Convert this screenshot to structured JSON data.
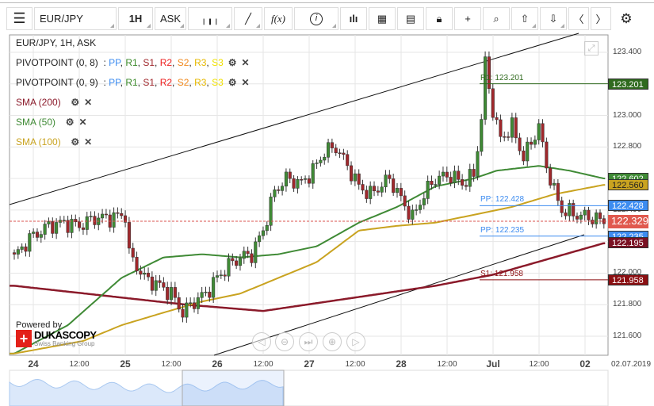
{
  "toolbar": {
    "menu_icon": "hamburger-icon",
    "symbol": "EUR/JPY",
    "period": "1H",
    "side": "ASK",
    "icons": [
      "candle-type-icon",
      "draw-pen-icon",
      "function-fx-icon",
      "info-icon",
      "volume-bars-icon",
      "calendar-icon",
      "report-icon",
      "lock-icon",
      "crosshair-icon",
      "zoom-search-icon",
      "upload-cloud-icon",
      "download-cloud-icon",
      "chevron-left-icon",
      "chevron-right-icon",
      "settings-gear-icon"
    ],
    "fx": "f(x)",
    "info": "i"
  },
  "legend": {
    "title": "EUR/JPY, 1H, ASK",
    "pivots": [
      {
        "name": "PIVOTPOINT (0, 8)"
      },
      {
        "name": "PIVOTPOINT (0, 9)"
      }
    ],
    "pivot_sep": ":",
    "pivot_parts": [
      {
        "t": "PP",
        "c": "#3d8cf0"
      },
      {
        "t": "R1",
        "c": "#3a8a2a"
      },
      {
        "t": "S1",
        "c": "#a0282c"
      },
      {
        "t": "R2",
        "c": "#ee2020"
      },
      {
        "t": "S2",
        "c": "#f08a20"
      },
      {
        "t": "R3",
        "c": "#e6b800"
      },
      {
        "t": "S3",
        "c": "#f0e000"
      }
    ],
    "smas": [
      {
        "name": "SMA (200)",
        "color": "#8b1a2a"
      },
      {
        "name": "SMA (50)",
        "color": "#3f8a35"
      },
      {
        "name": "SMA (100)",
        "color": "#c9a320"
      }
    ]
  },
  "levels": [
    {
      "label": "R1: 123.201",
      "value": 123.201,
      "tag": "123.201",
      "color": "#2f6a1e"
    },
    {
      "label": "PP: 122.428",
      "value": 122.428,
      "tag": "122.428",
      "color": "#3d8cf0"
    },
    {
      "label": "PP: 122.235",
      "value": 122.235,
      "tag": "122.235",
      "color": "#3d8cf0"
    },
    {
      "label": "S1: 121.958",
      "value": 121.958,
      "tag": "121.958",
      "color": "#8b0f12"
    }
  ],
  "tags": {
    "sma50": "122.602",
    "sma100": "122.560",
    "current": "122.329",
    "sma200": "122.195"
  },
  "current_price": 122.329,
  "yaxis": {
    "min": 121.5,
    "max": 123.5,
    "ticks": [
      "123.400",
      "123.200",
      "123.000",
      "122.800",
      "122.600",
      "122.400",
      "122.200",
      "122.000",
      "121.800",
      "121.600"
    ]
  },
  "xaxis": [
    {
      "t": "24",
      "major": true
    },
    {
      "t": "12:00"
    },
    {
      "t": "25",
      "major": true
    },
    {
      "t": "12:00"
    },
    {
      "t": "26",
      "major": true
    },
    {
      "t": "12:00"
    },
    {
      "t": "27",
      "major": true
    },
    {
      "t": "12:00"
    },
    {
      "t": "28",
      "major": true
    },
    {
      "t": "12:00"
    },
    {
      "t": "Jul",
      "major": true
    },
    {
      "t": "12:00"
    },
    {
      "t": "02",
      "major": true
    }
  ],
  "date_label": "02.07.2019",
  "brand": {
    "powered": "Powered by",
    "name": "DUKASCOPY",
    "sub": "Swiss Banking Group"
  },
  "nav_buttons": [
    "scroll-left-icon",
    "zoom-out-icon",
    "reset-icon",
    "zoom-in-icon",
    "scroll-right-icon"
  ],
  "chart_data": {
    "type": "candlestick",
    "hours": 155,
    "close_anchors": [
      [
        0,
        122.1
      ],
      [
        4,
        122.22
      ],
      [
        9,
        122.3
      ],
      [
        13,
        122.32
      ],
      [
        17,
        122.3
      ],
      [
        21,
        122.35
      ],
      [
        25,
        122.35
      ],
      [
        29,
        122.37
      ],
      [
        30,
        122.12
      ],
      [
        34,
        121.97
      ],
      [
        38,
        121.92
      ],
      [
        41,
        121.87
      ],
      [
        44,
        121.75
      ],
      [
        47,
        121.82
      ],
      [
        50,
        121.87
      ],
      [
        53,
        121.97
      ],
      [
        56,
        122.05
      ],
      [
        59,
        122.1
      ],
      [
        62,
        122.12
      ],
      [
        65,
        122.27
      ],
      [
        68,
        122.52
      ],
      [
        71,
        122.6
      ],
      [
        75,
        122.57
      ],
      [
        78,
        122.65
      ],
      [
        81,
        122.77
      ],
      [
        84,
        122.8
      ],
      [
        87,
        122.68
      ],
      [
        90,
        122.55
      ],
      [
        93,
        122.5
      ],
      [
        98,
        122.6
      ],
      [
        101,
        122.47
      ],
      [
        104,
        122.35
      ],
      [
        107,
        122.5
      ],
      [
        110,
        122.6
      ],
      [
        114,
        122.62
      ],
      [
        117,
        122.57
      ],
      [
        120,
        122.62
      ],
      [
        122,
        122.98
      ],
      [
        123,
        123.33
      ],
      [
        125,
        123.03
      ],
      [
        127,
        122.85
      ],
      [
        130,
        122.93
      ],
      [
        133,
        122.73
      ],
      [
        137,
        122.93
      ],
      [
        139,
        122.68
      ],
      [
        141,
        122.52
      ],
      [
        143,
        122.4
      ],
      [
        147,
        122.37
      ],
      [
        151,
        122.35
      ],
      [
        154,
        122.33
      ]
    ],
    "sma200": [
      [
        0,
        121.92
      ],
      [
        45,
        121.8
      ],
      [
        65,
        121.76
      ],
      [
        110,
        121.92
      ],
      [
        125,
        121.99
      ],
      [
        154,
        122.19
      ]
    ],
    "sma50": [
      [
        0,
        121.49
      ],
      [
        14,
        121.67
      ],
      [
        28,
        121.97
      ],
      [
        39,
        122.1
      ],
      [
        49,
        122.12
      ],
      [
        59,
        122.1
      ],
      [
        69,
        122.12
      ],
      [
        79,
        122.17
      ],
      [
        90,
        122.32
      ],
      [
        100,
        122.42
      ],
      [
        110,
        122.55
      ],
      [
        120,
        122.6
      ],
      [
        126,
        122.65
      ],
      [
        137,
        122.68
      ],
      [
        145,
        122.65
      ],
      [
        154,
        122.6
      ]
    ],
    "sma100": [
      [
        0,
        121.49
      ],
      [
        18,
        121.57
      ],
      [
        28,
        121.67
      ],
      [
        39,
        121.75
      ],
      [
        49,
        121.82
      ],
      [
        59,
        121.87
      ],
      [
        69,
        121.97
      ],
      [
        79,
        122.07
      ],
      [
        90,
        122.27
      ],
      [
        100,
        122.3
      ],
      [
        110,
        122.32
      ],
      [
        120,
        122.37
      ],
      [
        130,
        122.42
      ],
      [
        141,
        122.5
      ],
      [
        154,
        122.56
      ]
    ]
  }
}
